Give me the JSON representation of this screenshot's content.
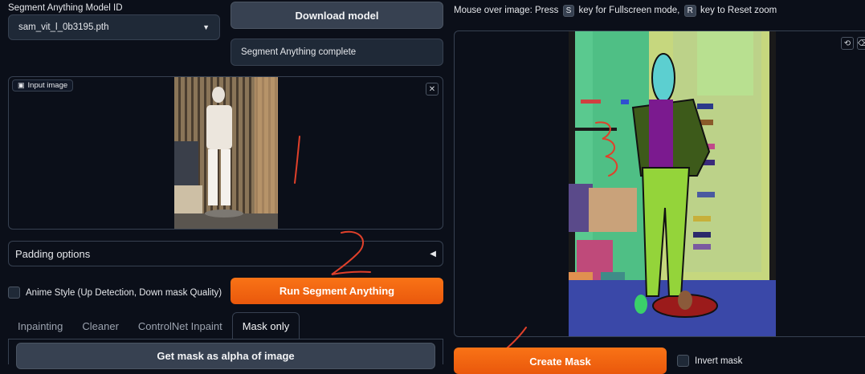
{
  "model": {
    "label": "Segment Anything Model ID",
    "selected": "sam_vit_l_0b3195.pth",
    "download_label": "Download model",
    "status": "Segment Anything complete"
  },
  "input_image": {
    "label": "Input image",
    "close_icon": "✕"
  },
  "padding": {
    "label": "Padding options",
    "toggle_icon": "◀"
  },
  "anime": {
    "label": "Anime Style (Up Detection, Down mask Quality)"
  },
  "run_label": "Run Segment Anything",
  "tabs": {
    "t0": "Inpainting",
    "t1": "Cleaner",
    "t2": "ControlNet Inpaint",
    "t3": "Mask only"
  },
  "get_mask_label": "Get mask as alpha of image",
  "hint": {
    "p1": "Mouse over image: Press",
    "k1": "S",
    "p2": "key for Fullscreen mode,",
    "k2": "R",
    "p3": "key to Reset zoom"
  },
  "create_mask_label": "Create Mask",
  "invert_mask_label": "Invert mask",
  "colors": {
    "accent": "#f97316",
    "background": "#0b0f19",
    "panel_border": "#374151"
  }
}
